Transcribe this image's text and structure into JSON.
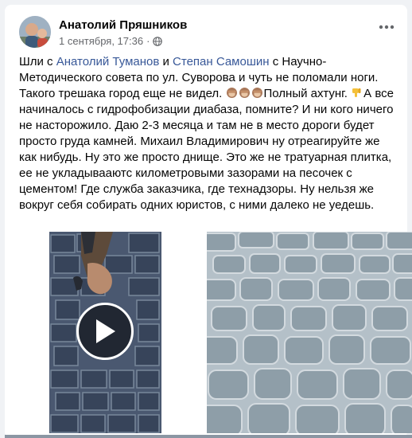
{
  "post": {
    "author": "Анатолий Пряшников",
    "timestamp": "1 сентября, 17:36",
    "separator": "·",
    "privacy_icon": "globe-icon",
    "more_icon": "more-horizontal-icon",
    "text": {
      "t1": "Шли с ",
      "mention1": "Анатолий Туманов",
      "t2": " и ",
      "mention2": "Степан Самошин",
      "t3": " с Научно-Методического совета по ул. Суворова и чуть не поломали ноги. Такого трешака город еще не видел. ",
      "t4": "Полный ахтунг. ",
      "t5": "А все начиналось с гидрофобизации диабаза, помните? И ни кого ничего не насторожило. Даю 2-3 месяца и там не в место дороги будет просто груда камней.  Михаил Владимирович ну отреагируйте же как нибудь. Ну это же просто днище. Это же не тратуарная плитка, ее не укладывааютс километровыми зазорами на песочек с цементом! Где  служба заказчика, где технадзоры. Ну нельзя же вокруг себя собирать одних юристов, с ними далеко не уедешь."
    },
    "emojis": [
      "see-no-evil-monkey-icon",
      "see-no-evil-monkey-icon",
      "see-no-evil-monkey-icon",
      "thumbs-down-icon"
    ],
    "media": [
      {
        "type": "video",
        "icon": "play-icon",
        "subject": "cobblestone-pavement-with-hand"
      },
      {
        "type": "photo",
        "subject": "cobblestone-pavement-closeup"
      }
    ]
  }
}
